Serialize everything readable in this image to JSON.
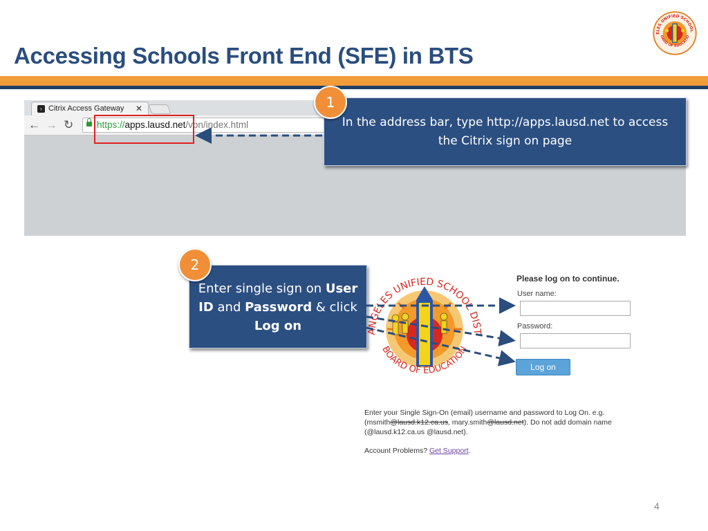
{
  "slide": {
    "title": "Accessing Schools Front End (SFE) in BTS",
    "page_number": "4"
  },
  "colors": {
    "title": "#2a4d7e",
    "accent_bar": "#f29b3a",
    "navy_bar": "#1f3e66",
    "callout": "#2c4f82",
    "badge": "#f08f38",
    "highlight": "#e0201e"
  },
  "browser": {
    "tab_title": "Citrix Access Gateway",
    "tab_close": "✕",
    "back": "←",
    "forward": "→",
    "reload": "↻",
    "url_scheme": "https://",
    "url_host": "apps.lausd.net",
    "url_path": "/vpn/index.html"
  },
  "step1": {
    "number": "1",
    "text": "In the address bar, type http://apps.lausd.net to access the Citrix sign on page"
  },
  "step2": {
    "number": "2",
    "t1": "Enter single sign on ",
    "t2": "User ID",
    "t3": " and ",
    "t4": "Password",
    "t5": " & click ",
    "t6": "Log on"
  },
  "login": {
    "heading": "Please log on to continue.",
    "username_label": "User name:",
    "password_label": "Password:",
    "logon_button": "Log on",
    "note_a": "Enter your Single Sign-On (email) username and password to Log On. e.g. (msmith",
    "note_b": "@lausd.k12.ca.us",
    "note_c": ", mary.smith",
    "note_d": "@lausd.net",
    "note_e": "). Do not add domain name (@lausd.k12.ca.us @lausd.net).",
    "support_prefix": "Account Problems? ",
    "support_link": "Get Support",
    "support_suffix": "."
  },
  "seal": {
    "top_text": "LOS ANGELES UNIFIED SCHOOL DISTRICT",
    "bottom_text": "BOARD OF EDUCATION"
  }
}
